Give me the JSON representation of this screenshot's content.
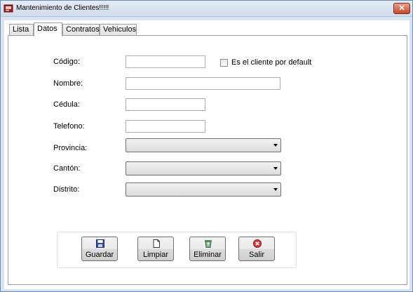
{
  "window": {
    "title": "Mantenimiento de Clientes!!!!!",
    "close_glyph": "✕"
  },
  "tabs": [
    {
      "label": "Lista"
    },
    {
      "label": "Datos"
    },
    {
      "label": "Contratos"
    },
    {
      "label": "Vehiculos"
    }
  ],
  "form": {
    "codigo_label": "Código:",
    "codigo_value": "",
    "default_checkbox_label": "Es el cliente por default",
    "default_checked": false,
    "nombre_label": "Nombre:",
    "nombre_value": "",
    "cedula_label": "Cédula:",
    "cedula_value": "",
    "telefono_label": "Telefono:",
    "telefono_value": "",
    "provincia_label": "Provincia:",
    "provincia_value": "",
    "canton_label": "Cantón:",
    "canton_value": "",
    "distrito_label": "Distrito:",
    "distrito_value": ""
  },
  "actions": {
    "guardar": "Guardar",
    "limpiar": "Limpiar",
    "eliminar": "Eliminar",
    "salir": "Salir"
  },
  "icons": {
    "app": "red-card-icon",
    "guardar": "floppy-disk-icon",
    "limpiar": "blank-page-icon",
    "eliminar": "recycle-bin-icon",
    "salir": "red-x-circle-icon"
  },
  "colors": {
    "window_frame": "#d9e4f1",
    "close_button": "#c7472c",
    "panel_background": "#ffffff"
  }
}
